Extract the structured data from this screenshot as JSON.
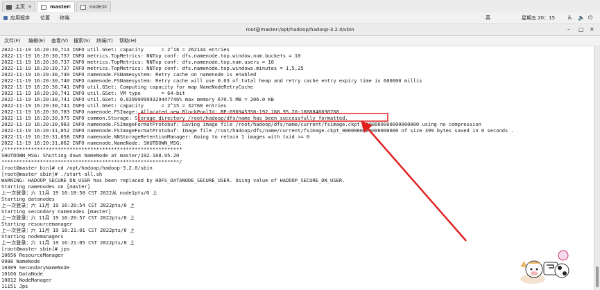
{
  "tabs": [
    {
      "label": "主页",
      "icon": "home-icon"
    },
    {
      "label": "master",
      "icon": "terminal-icon"
    },
    {
      "label": "node1",
      "icon": "terminal-icon"
    }
  ],
  "top_menu": {
    "apps": "应用程序",
    "places": "位置",
    "terminal": "终端"
  },
  "system": {
    "input_method": "英",
    "clock": "星期五 20：15"
  },
  "window": {
    "title": "root@master:/opt/hadoop/hadoop-3.2.0/sbin"
  },
  "menu": [
    "文件(F)",
    "编辑(E)",
    "查看(V)",
    "搜索(S)",
    "终端(T)",
    "帮助(H)"
  ],
  "terminal_lines": [
    "2022-11-19 16:20:30,714 INFO util.GSet: capacity      = 2^18 = 262144 entries",
    "2022-11-19 16:20:30,737 INFO metrics.TopMetrics: NNTop conf: dfs.namenode.top.window.num.buckets = 10",
    "2022-11-19 16:20:30,737 INFO metrics.TopMetrics: NNTop conf: dfs.namenode.top.num.users = 10",
    "2022-11-19 16:20:30,737 INFO metrics.TopMetrics: NNTop conf: dfs.namenode.top.windows.minutes = 1,5,25",
    "2022-11-19 16:20:30,740 INFO namenode.FSNamesystem: Retry cache on namenode is enabled",
    "2022-11-19 16:20:30,740 INFO namenode.FSNamesystem: Retry cache will use 0.03 of total heap and retry cache entry expiry time is 600000 millis",
    "2022-11-19 16:20:30,741 INFO util.GSet: Computing capacity for map NameNodeRetryCache",
    "2022-11-19 16:20:30,741 INFO util.GSet: VM type       = 64-bit",
    "2022-11-19 16:20:30,741 INFO util.GSet: 0.029999999329447746% max memory 670.5 MB = 206.0 KB",
    "2022-11-19 16:20:30,741 INFO util.GSet: capacity      = 2^15 = 32768 entries",
    "2022-11-19 16:20:30,783 INFO namenode.FSImage: Allocated new BlockPoolId: BP-696945350-192.168.95.20-1668846030768",
    "2022-11-19 16:20:30,975 INFO common.Storage: Storage directory /root/hadoop/dfs/name has been successfully formatted.",
    "2022-11-19 16:20:30,983 INFO namenode.FSImageFormatProtobuf: Saving image file /root/hadoop/dfs/name/current/fsimage.ckpt_0000000000000000000 using no compression",
    "2022-11-19 16:20:31,052 INFO namenode.FSImageFormatProtobuf: Image file /root/hadoop/dfs/name/current/fsimage.ckpt_0000000000000000000 of size 399 bytes saved in 0 seconds .",
    "2022-11-19 16:20:31,058 INFO namenode.NNStorageRetentionManager: Going to retain 1 images with txid >= 0",
    "2022-11-19 16:20:31,062 INFO namenode.NameNode: SHUTDOWN_MSG:",
    "/************************************************************",
    "SHUTDOWN_MSG: Shutting down NameNode at master/192.168.95.20",
    "************************************************************/",
    "[root@master bin]# cd /opt/hadoop/hadoop-3.2.0/sbin",
    "[root@master sbin]# ./start-all.sh",
    "WARNING: HADOOP_SECURE_DN_USER has been replaced by HDFS_DATANODE_SECURE_USER. Using value of HADOOP_SECURE_DN_USER.",
    "Starting namenodes on [master]",
    "上一次登录：六 11月 19 16:18:58 CST 2022从 node1pts/0 上",
    "Starting datanodes",
    "上一次登录：六 11月 19 16:20:54 CST 2022pts/0 上",
    "Starting secondary namenodes [master]",
    "上一次登录：六 11月 19 16:20:57 CST 2022pts/0 上",
    "Starting resourcemanager",
    "上一次登录：六 11月 19 16:21:01 CST 2022pts/0 上",
    "Starting nodemanagers",
    "上一次登录：六 11月 19 16:21:05 CST 2022pts/0 上",
    "[root@master sbin]# jps",
    "10656 ResourceManager",
    "9988 NameNode",
    "10389 SecondaryNameNode",
    "10166 DataNode",
    "10812 NodeManager",
    "11151 Jps"
  ],
  "highlight": {
    "text": "Storage directory /root/hadoop/dfs/name has been successfully formatted.",
    "color": "#e02020"
  },
  "colors": {
    "annotation": "#e02020",
    "terminal_bg": "#ffffff",
    "terminal_fg": "#1a1a1a"
  }
}
